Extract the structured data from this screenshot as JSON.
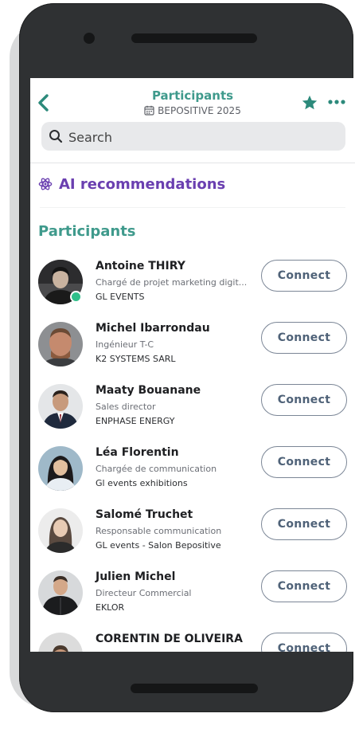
{
  "header": {
    "title": "Participants",
    "event": "BEPOSITIVE 2025"
  },
  "search": {
    "placeholder": "Search"
  },
  "ai": {
    "label": "AI recommendations"
  },
  "section": {
    "title": "Participants"
  },
  "colors": {
    "accent": "#3f9a8c",
    "ai_purple": "#6a3fb0",
    "online": "#2fbf8a"
  },
  "icons": [
    "back-chevron-icon",
    "calendar-icon",
    "star-icon",
    "more-dots-icon",
    "search-icon",
    "atom-icon"
  ],
  "participants": [
    {
      "name": "Antoine THIRY",
      "title": "Chargé de projet marketing digit...",
      "company": "GL EVENTS",
      "online": true,
      "action": "Connect"
    },
    {
      "name": "Michel Ibarrondau",
      "title": "Ingénieur T-C",
      "company": "K2 SYSTEMS SARL",
      "online": false,
      "action": "Connect"
    },
    {
      "name": "Maaty Bouanane",
      "title": "Sales director",
      "company": "ENPHASE ENERGY",
      "online": false,
      "action": "Connect"
    },
    {
      "name": "Léa Florentin",
      "title": "Chargée de communication",
      "company": "Gl events exhibitions",
      "online": false,
      "action": "Connect"
    },
    {
      "name": "Salomé Truchet",
      "title": "Responsable communication",
      "company": "GL events - Salon Bepositive",
      "online": false,
      "action": "Connect"
    },
    {
      "name": "Julien Michel",
      "title": "Directeur Commercial",
      "company": "EKLOR",
      "online": false,
      "action": "Connect"
    },
    {
      "name": "CORENTIN DE OLIVEIRA",
      "title": "",
      "company": "",
      "online": false,
      "action": "Connect"
    }
  ]
}
